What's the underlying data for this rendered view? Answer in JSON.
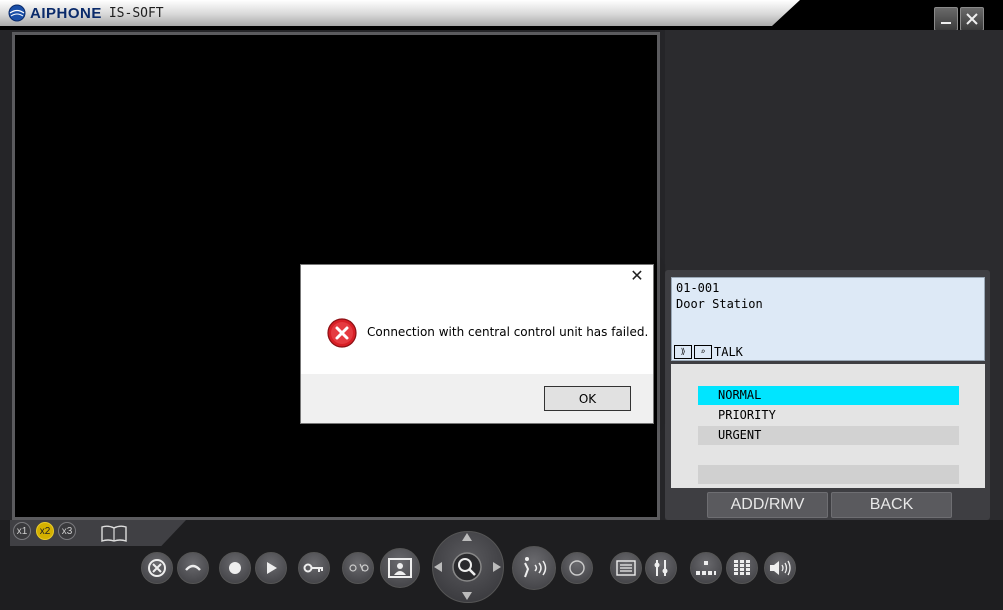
{
  "app": {
    "brand": "AIPHONE",
    "product": "IS-SOFT",
    "minimize_icon": "minimize-icon",
    "close_icon": "close-icon"
  },
  "station": {
    "id": "01-001",
    "name": "Door Station",
    "status_text": "TALK"
  },
  "priority_list": {
    "items": [
      {
        "label": "NORMAL",
        "selected": true
      },
      {
        "label": "PRIORITY",
        "selected": false
      },
      {
        "label": "URGENT",
        "selected": false
      }
    ],
    "colors": {
      "selected": "#00e5ff",
      "urgent": "#d2d2d2"
    }
  },
  "buttons": {
    "add_rmv": "ADD/RMV",
    "back": "BACK"
  },
  "zoom": {
    "options": [
      "x1",
      "x2",
      "x3"
    ],
    "active": "x2"
  },
  "dialog": {
    "message": "Connection with central control unit has failed.",
    "ok_label": "OK",
    "close_glyph": "✕"
  },
  "colors": {
    "accent": "#00e5ff",
    "zoom_active": "#d4b000"
  }
}
